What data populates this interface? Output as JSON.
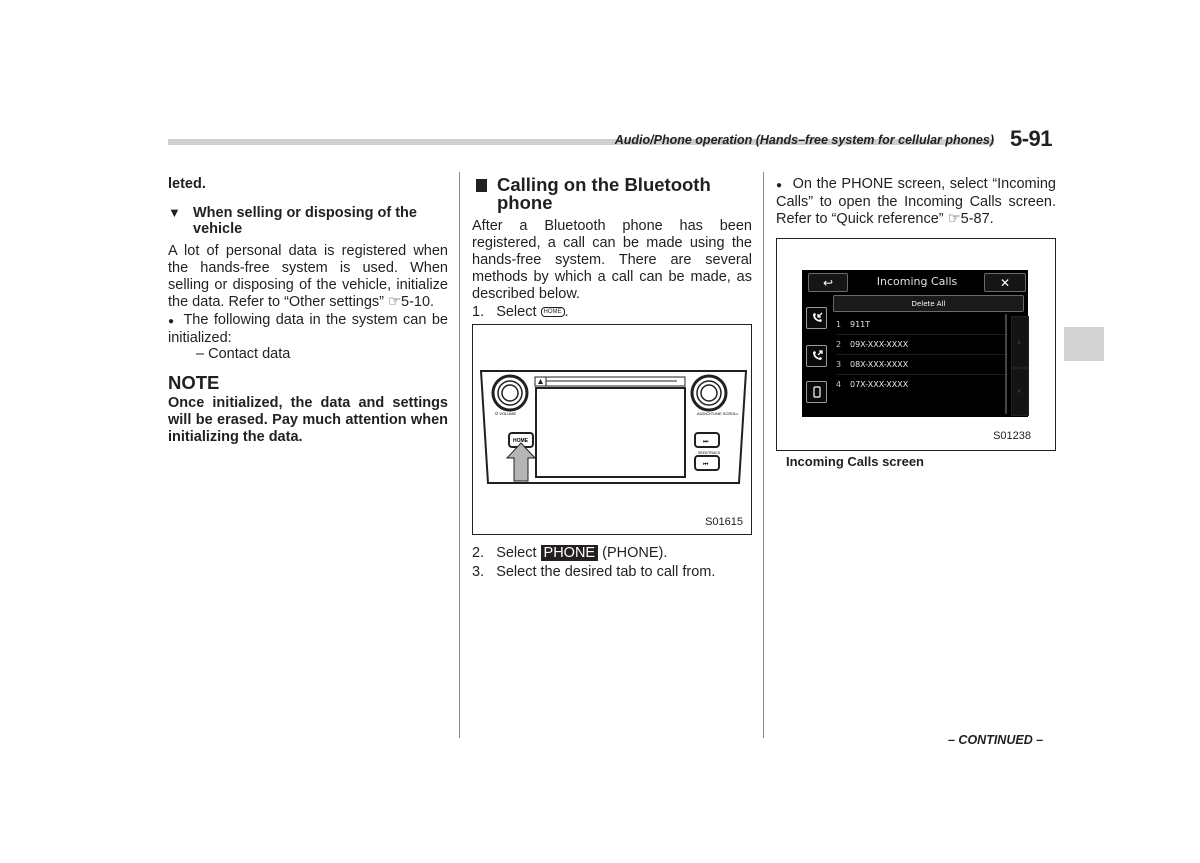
{
  "header": {
    "title": "Audio/Phone operation (Hands–free system for cellular phones)",
    "page_number": "5-91"
  },
  "column1": {
    "continuation": "leted.",
    "subheading_marker": "▼",
    "subheading": "When selling or disposing of the vehicle",
    "paragraph": "A lot of personal data is registered when the hands-free system is used. When selling or disposing of the vehicle, initialize the data. Refer to “Other settings” ☞5-10.",
    "bullet": "The following data in the system can be initialized:",
    "sub_item": "– Contact data",
    "note_title": "NOTE",
    "note_text": "Once initialized, the data and settings will be erased. Pay much attention when initializing the data."
  },
  "column2": {
    "section_heading": "Calling on the Bluetooth phone",
    "paragraph": "After a Bluetooth phone has been registered, a call can be made using the hands-free system. There are several methods by which a call can be made, as described below.",
    "step1_prefix": "1.",
    "step1_text": "Select",
    "step1_key": "HOME",
    "figure": {
      "code": "S01615",
      "labels": {
        "volume": "⏻ VOLUME",
        "audio_tune": "AUDIO/TUNE SCROLL",
        "home": "HOME",
        "seek_track": "SEEK/TRACK",
        "next": "⏭",
        "prev": "⏮"
      }
    },
    "step2_prefix": "2.",
    "step2_text": "Select",
    "step2_key": "PHONE",
    "step2_suffix": "(PHONE).",
    "step3_prefix": "3.",
    "step3_text": "Select the desired tab to call from."
  },
  "column3": {
    "bullet": "On the PHONE screen, select “Incoming Calls” to open the Incoming Calls screen. Refer to “Quick reference” ☞5-87.",
    "figure": {
      "code": "S01238",
      "caption": "Incoming Calls screen",
      "screen": {
        "title": "Incoming Calls",
        "back_icon": "↩",
        "close_icon": "✕",
        "delete_all": "Delete All",
        "entries": [
          {
            "num": "1",
            "number": "911T"
          },
          {
            "num": "2",
            "number": "09X-XXX-XXXX"
          },
          {
            "num": "3",
            "number": "08X-XXX-XXXX"
          },
          {
            "num": "4",
            "number": "07X-XXX-XXXX"
          }
        ],
        "tabs": [
          "incoming-call",
          "outgoing-call",
          "phonebook"
        ]
      }
    }
  },
  "footer": {
    "continued": "– CONTINUED –"
  }
}
